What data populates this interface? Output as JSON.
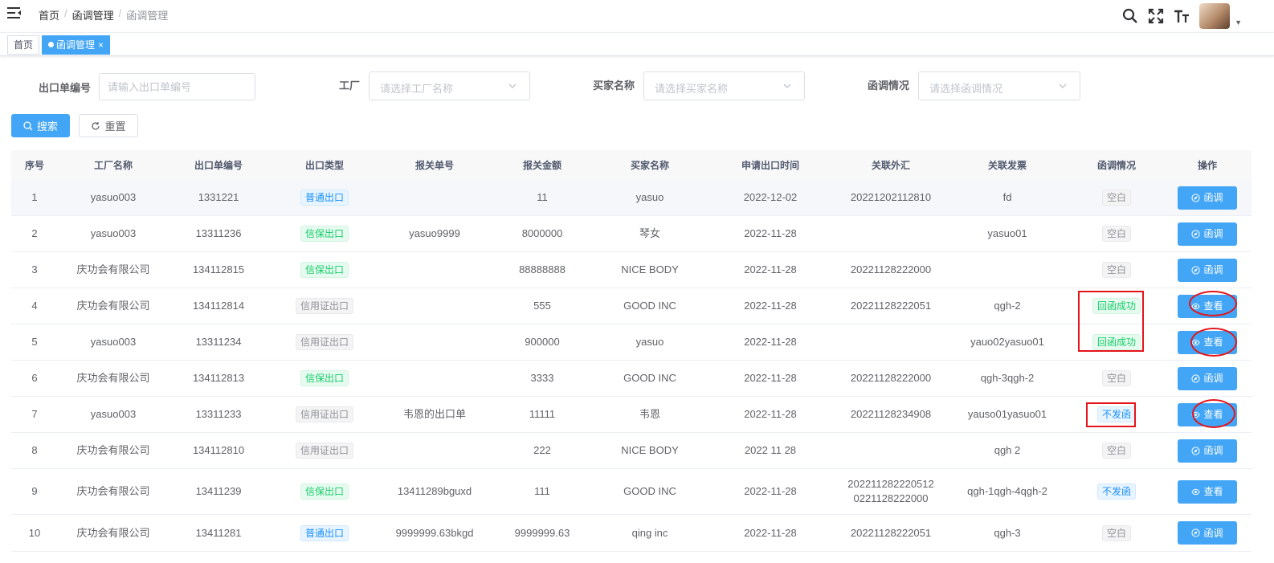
{
  "breadcrumb": [
    "首页",
    "函调管理",
    "函调管理"
  ],
  "tabs": [
    {
      "label": "首页"
    },
    {
      "label": "函调管理",
      "close": "×"
    }
  ],
  "filters": {
    "export_no": {
      "label": "出口单编号",
      "placeholder": "请输入出口单编号"
    },
    "factory": {
      "label": "工厂",
      "placeholder": "请选择工厂名称"
    },
    "buyer": {
      "label": "买家名称",
      "placeholder": "请选择买家名称"
    },
    "letter_status": {
      "label": "函调情况",
      "placeholder": "请选择函调情况"
    }
  },
  "buttons": {
    "search": "搜索",
    "reset": "重置"
  },
  "table": {
    "columns": [
      "序号",
      "工厂名称",
      "出口单编号",
      "出口类型",
      "报关单号",
      "报关金额",
      "买家名称",
      "申请出口时间",
      "关联外汇",
      "关联发票",
      "函调情况",
      "操作"
    ],
    "rows": [
      {
        "no": "1",
        "factory": "yasuo003",
        "export_no": "1331221",
        "type": "普通出口",
        "type_style": "blue",
        "customs_no": "",
        "amount": "11",
        "buyer": "yasuo",
        "date": "2022-12-02",
        "forex": "20221202112810",
        "forex2": "",
        "invoice": "fd",
        "status": "空白",
        "status_style": "gray",
        "action": "函调",
        "action_icon": "compass"
      },
      {
        "no": "2",
        "factory": "yasuo003",
        "export_no": "13311236",
        "type": "信保出口",
        "type_style": "green",
        "customs_no": "yasuo9999",
        "amount": "8000000",
        "buyer": "琴女",
        "date": "2022-11-28",
        "forex": "",
        "forex2": "",
        "invoice": "yasuo01",
        "status": "空白",
        "status_style": "gray",
        "action": "函调",
        "action_icon": "compass"
      },
      {
        "no": "3",
        "factory": "庆功会有限公司",
        "export_no": "134112815",
        "type": "信保出口",
        "type_style": "green",
        "customs_no": "",
        "amount": "88888888",
        "buyer": "NICE BODY",
        "date": "2022-11-28",
        "forex": "20221128222000",
        "forex2": "",
        "invoice": "",
        "status": "空白",
        "status_style": "gray",
        "action": "函调",
        "action_icon": "compass"
      },
      {
        "no": "4",
        "factory": "庆功会有限公司",
        "export_no": "134112814",
        "type": "信用证出口",
        "type_style": "gray",
        "customs_no": "",
        "amount": "555",
        "buyer": "GOOD INC",
        "date": "2022-11-28",
        "forex": "20221128222051",
        "forex2": "",
        "invoice": "qgh-2",
        "status": "回函成功",
        "status_style": "green",
        "action": "查看",
        "action_icon": "eye"
      },
      {
        "no": "5",
        "factory": "yasuo003",
        "export_no": "13311234",
        "type": "信用证出口",
        "type_style": "gray",
        "customs_no": "",
        "amount": "900000",
        "buyer": "yasuo",
        "date": "2022-11-28",
        "forex": "",
        "forex2": "",
        "invoice": "yauo02yasuo01",
        "status": "回函成功",
        "status_style": "green",
        "action": "查看",
        "action_icon": "eye"
      },
      {
        "no": "6",
        "factory": "庆功会有限公司",
        "export_no": "134112813",
        "type": "信保出口",
        "type_style": "green",
        "customs_no": "",
        "amount": "3333",
        "buyer": "GOOD INC",
        "date": "2022-11-28",
        "forex": "20221128222000",
        "forex2": "",
        "invoice": "qgh-3qgh-2",
        "status": "空白",
        "status_style": "gray",
        "action": "函调",
        "action_icon": "compass"
      },
      {
        "no": "7",
        "factory": "yasuo003",
        "export_no": "13311233",
        "type": "信用证出口",
        "type_style": "gray",
        "customs_no": "韦恩的出口单",
        "amount": "11111",
        "buyer": "韦恩",
        "date": "2022-11-28",
        "forex": "20221128234908",
        "forex2": "",
        "invoice": "yauso01yasuo01",
        "status": "不发函",
        "status_style": "blue",
        "action": "查看",
        "action_icon": "eye"
      },
      {
        "no": "8",
        "factory": "庆功会有限公司",
        "export_no": "134112810",
        "type": "信用证出口",
        "type_style": "gray",
        "customs_no": "",
        "amount": "222",
        "buyer": "NICE BODY",
        "date": "2022 11 28",
        "forex": "",
        "forex2": "",
        "invoice": "qgh 2",
        "status": "空白",
        "status_style": "gray",
        "action": "函调",
        "action_icon": "compass"
      },
      {
        "no": "9",
        "factory": "庆功会有限公司",
        "export_no": "13411239",
        "type": "信保出口",
        "type_style": "green",
        "customs_no": "13411289bguxd",
        "amount": "111",
        "buyer": "GOOD INC",
        "date": "2022-11-28",
        "forex": "202211282220512",
        "forex2": "0221128222000",
        "invoice": "qgh-1qgh-4qgh-2",
        "status": "不发函",
        "status_style": "blue",
        "action": "查看",
        "action_icon": "eye"
      },
      {
        "no": "10",
        "factory": "庆功会有限公司",
        "export_no": "13411281",
        "type": "普通出口",
        "type_style": "blue",
        "customs_no": "9999999.63bkgd",
        "amount": "9999999.63",
        "buyer": "qing inc",
        "date": "2022-11-28",
        "forex": "20221128222051",
        "forex2": "",
        "invoice": "qgh-3",
        "status": "空白",
        "status_style": "gray",
        "action": "函调",
        "action_icon": "compass"
      }
    ]
  },
  "colors": {
    "primary": "#42a5f5",
    "annotation": "#e5141b"
  }
}
